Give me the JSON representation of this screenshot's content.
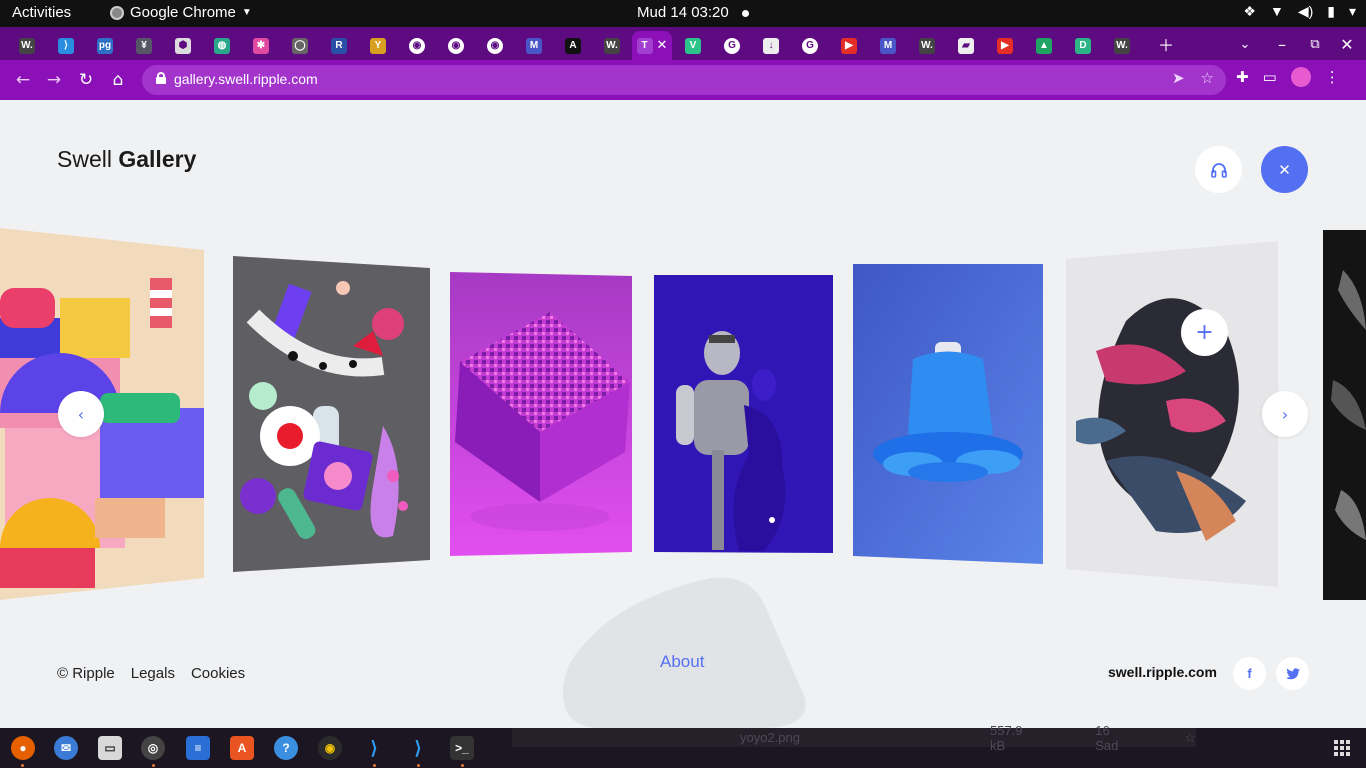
{
  "topbar": {
    "activities": "Activities",
    "app_name": "Google Chrome",
    "clock": "Mud 14  03:20"
  },
  "tabs": [
    {
      "icon": "wikipedia-icon",
      "glyph": "W."
    },
    {
      "icon": "vscode-icon",
      "glyph": "⟩"
    },
    {
      "icon": "pg-icon",
      "glyph": "pg"
    },
    {
      "icon": "tree-icon",
      "glyph": "¥"
    },
    {
      "icon": "hexagon-icon",
      "glyph": "⬢"
    },
    {
      "icon": "globe-icon",
      "glyph": "◍"
    },
    {
      "icon": "pinwheel-icon",
      "glyph": "✱"
    },
    {
      "icon": "github-icon",
      "glyph": "◯"
    },
    {
      "icon": "r-icon",
      "glyph": "R"
    },
    {
      "icon": "y-icon",
      "glyph": "Y"
    },
    {
      "icon": "web-icon",
      "glyph": "◉"
    },
    {
      "icon": "web-icon",
      "glyph": "◉"
    },
    {
      "icon": "web-icon",
      "glyph": "◉"
    },
    {
      "icon": "m-plus-icon",
      "glyph": "M"
    },
    {
      "icon": "a-icon",
      "glyph": "A"
    },
    {
      "icon": "wikipedia-icon",
      "glyph": "W."
    },
    {
      "icon": "ripple-icon",
      "glyph": "T",
      "active": true
    },
    {
      "icon": "v-icon",
      "glyph": "V"
    },
    {
      "icon": "google-icon",
      "glyph": "G"
    },
    {
      "icon": "download-icon",
      "glyph": "↓"
    },
    {
      "icon": "google-icon",
      "glyph": "G"
    },
    {
      "icon": "youtube-icon",
      "glyph": "▶"
    },
    {
      "icon": "m-plus-icon",
      "glyph": "M"
    },
    {
      "icon": "wikipedia-icon",
      "glyph": "W."
    },
    {
      "icon": "laptop-icon",
      "glyph": "▰"
    },
    {
      "icon": "youtube-icon",
      "glyph": "▶"
    },
    {
      "icon": "drive-icon",
      "glyph": "▲"
    },
    {
      "icon": "d-icon",
      "glyph": "D"
    },
    {
      "icon": "wikipedia-icon",
      "glyph": "W."
    }
  ],
  "address": {
    "url": "gallery.swell.ripple.com"
  },
  "page": {
    "logo_light": "Swell",
    "logo_bold": "Gallery",
    "about": "About",
    "footer_links": [
      "© Ripple",
      "Legals",
      "Cookies"
    ],
    "domain": "swell.ripple.com"
  },
  "taskbar": {
    "download_file": "yoyo2.png",
    "download_size": "557.9 kB",
    "download_time": "16 Sad"
  },
  "colors": {
    "accent": "#5470f2",
    "tabstrip": "#5e0a80",
    "toolbar": "#8b10b8",
    "background": "#f0f1f3"
  }
}
